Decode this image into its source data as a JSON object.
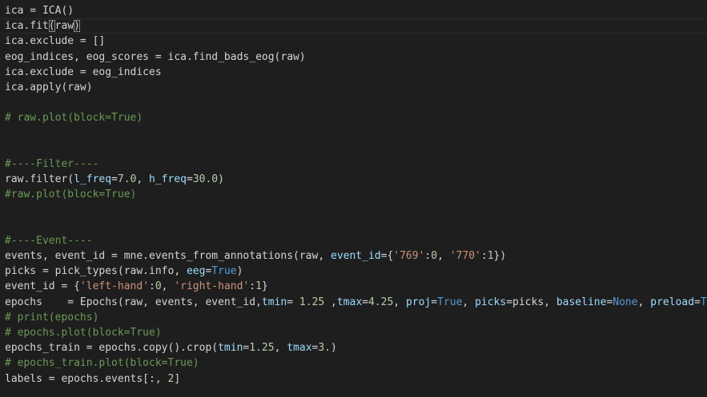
{
  "editor": {
    "lines": [
      {
        "kind": "code",
        "segments": [
          {
            "t": "plain",
            "v": "ica = ICA()"
          }
        ]
      },
      {
        "kind": "code",
        "current": true,
        "segments": [
          {
            "t": "plain",
            "v": "ica.fit"
          },
          {
            "t": "bracket",
            "v": "("
          },
          {
            "t": "plain",
            "v": "raw"
          },
          {
            "t": "bracket",
            "v": ")"
          }
        ]
      },
      {
        "kind": "code",
        "segments": [
          {
            "t": "plain",
            "v": "ica.exclude = []"
          }
        ]
      },
      {
        "kind": "code",
        "segments": [
          {
            "t": "plain",
            "v": "eog_indices, eog_scores = ica.find_bads_eog(raw)"
          }
        ]
      },
      {
        "kind": "code",
        "segments": [
          {
            "t": "plain",
            "v": "ica.exclude = eog_indices"
          }
        ]
      },
      {
        "kind": "code",
        "segments": [
          {
            "t": "plain",
            "v": "ica.apply(raw)"
          }
        ]
      },
      {
        "kind": "blank",
        "segments": [
          {
            "t": "plain",
            "v": ""
          }
        ]
      },
      {
        "kind": "comment",
        "segments": [
          {
            "t": "comment",
            "v": "# raw.plot(block=True)"
          }
        ]
      },
      {
        "kind": "blank",
        "segments": [
          {
            "t": "plain",
            "v": ""
          }
        ]
      },
      {
        "kind": "blank",
        "segments": [
          {
            "t": "plain",
            "v": ""
          }
        ]
      },
      {
        "kind": "comment",
        "segments": [
          {
            "t": "comment",
            "v": "#----Filter----"
          }
        ]
      },
      {
        "kind": "code",
        "segments": [
          {
            "t": "plain",
            "v": "raw.filter("
          },
          {
            "t": "param",
            "v": "l_freq"
          },
          {
            "t": "plain",
            "v": "="
          },
          {
            "t": "number",
            "v": "7.0"
          },
          {
            "t": "plain",
            "v": ", "
          },
          {
            "t": "param",
            "v": "h_freq"
          },
          {
            "t": "plain",
            "v": "="
          },
          {
            "t": "number",
            "v": "30.0"
          },
          {
            "t": "plain",
            "v": ")"
          }
        ]
      },
      {
        "kind": "comment",
        "segments": [
          {
            "t": "comment",
            "v": "#raw.plot(block=True)"
          }
        ]
      },
      {
        "kind": "blank",
        "segments": [
          {
            "t": "plain",
            "v": ""
          }
        ]
      },
      {
        "kind": "blank",
        "segments": [
          {
            "t": "plain",
            "v": ""
          }
        ]
      },
      {
        "kind": "comment",
        "segments": [
          {
            "t": "comment",
            "v": "#----Event----"
          }
        ]
      },
      {
        "kind": "code",
        "segments": [
          {
            "t": "plain",
            "v": "events, event_id = mne.events_from_annotations(raw, "
          },
          {
            "t": "param",
            "v": "event_id"
          },
          {
            "t": "plain",
            "v": "={"
          },
          {
            "t": "string",
            "v": "'769'"
          },
          {
            "t": "plain",
            "v": ":"
          },
          {
            "t": "number",
            "v": "0"
          },
          {
            "t": "plain",
            "v": ", "
          },
          {
            "t": "string",
            "v": "'770'"
          },
          {
            "t": "plain",
            "v": ":"
          },
          {
            "t": "number",
            "v": "1"
          },
          {
            "t": "plain",
            "v": "})"
          }
        ]
      },
      {
        "kind": "code",
        "segments": [
          {
            "t": "plain",
            "v": "picks = pick_types(raw.info, "
          },
          {
            "t": "param",
            "v": "eeg"
          },
          {
            "t": "plain",
            "v": "="
          },
          {
            "t": "const",
            "v": "True"
          },
          {
            "t": "plain",
            "v": ")"
          }
        ]
      },
      {
        "kind": "code",
        "segments": [
          {
            "t": "plain",
            "v": "event_id = {"
          },
          {
            "t": "string",
            "v": "'left-hand'"
          },
          {
            "t": "plain",
            "v": ":"
          },
          {
            "t": "number",
            "v": "0"
          },
          {
            "t": "plain",
            "v": ", "
          },
          {
            "t": "string",
            "v": "'right-hand'"
          },
          {
            "t": "plain",
            "v": ":"
          },
          {
            "t": "number",
            "v": "1"
          },
          {
            "t": "plain",
            "v": "}"
          }
        ]
      },
      {
        "kind": "code",
        "segments": [
          {
            "t": "plain",
            "v": "epochs    = Epochs(raw, events, event_id,"
          },
          {
            "t": "param",
            "v": "tmin"
          },
          {
            "t": "plain",
            "v": "= "
          },
          {
            "t": "number",
            "v": "1.25"
          },
          {
            "t": "plain",
            "v": " ,"
          },
          {
            "t": "param",
            "v": "tmax"
          },
          {
            "t": "plain",
            "v": "="
          },
          {
            "t": "number",
            "v": "4.25"
          },
          {
            "t": "plain",
            "v": ", "
          },
          {
            "t": "param",
            "v": "proj"
          },
          {
            "t": "plain",
            "v": "="
          },
          {
            "t": "const",
            "v": "True"
          },
          {
            "t": "plain",
            "v": ", "
          },
          {
            "t": "param",
            "v": "picks"
          },
          {
            "t": "plain",
            "v": "=picks, "
          },
          {
            "t": "param",
            "v": "baseline"
          },
          {
            "t": "plain",
            "v": "="
          },
          {
            "t": "const",
            "v": "None"
          },
          {
            "t": "plain",
            "v": ", "
          },
          {
            "t": "param",
            "v": "preload"
          },
          {
            "t": "plain",
            "v": "="
          },
          {
            "t": "const",
            "v": "True"
          }
        ]
      },
      {
        "kind": "comment",
        "segments": [
          {
            "t": "comment",
            "v": "# print(epochs)"
          }
        ]
      },
      {
        "kind": "comment",
        "segments": [
          {
            "t": "comment",
            "v": "# epochs.plot(block=True)"
          }
        ]
      },
      {
        "kind": "code",
        "segments": [
          {
            "t": "plain",
            "v": "epochs_train = epochs.copy().crop("
          },
          {
            "t": "param",
            "v": "tmin"
          },
          {
            "t": "plain",
            "v": "="
          },
          {
            "t": "number",
            "v": "1.25"
          },
          {
            "t": "plain",
            "v": ", "
          },
          {
            "t": "param",
            "v": "tmax"
          },
          {
            "t": "plain",
            "v": "="
          },
          {
            "t": "number",
            "v": "3."
          },
          {
            "t": "plain",
            "v": ")"
          }
        ]
      },
      {
        "kind": "comment",
        "segments": [
          {
            "t": "comment",
            "v": "# epochs_train.plot(block=True)"
          }
        ]
      },
      {
        "kind": "code",
        "segments": [
          {
            "t": "plain",
            "v": "labels = epochs.events[:, "
          },
          {
            "t": "number",
            "v": "2"
          },
          {
            "t": "plain",
            "v": "]"
          }
        ]
      }
    ]
  },
  "colors": {
    "background": "#1e1e1e",
    "plain": "#d4d4d4",
    "comment": "#6a9955",
    "param": "#9cdcfe",
    "string": "#ce9178",
    "number": "#b5cea8",
    "const": "#569cd6"
  }
}
